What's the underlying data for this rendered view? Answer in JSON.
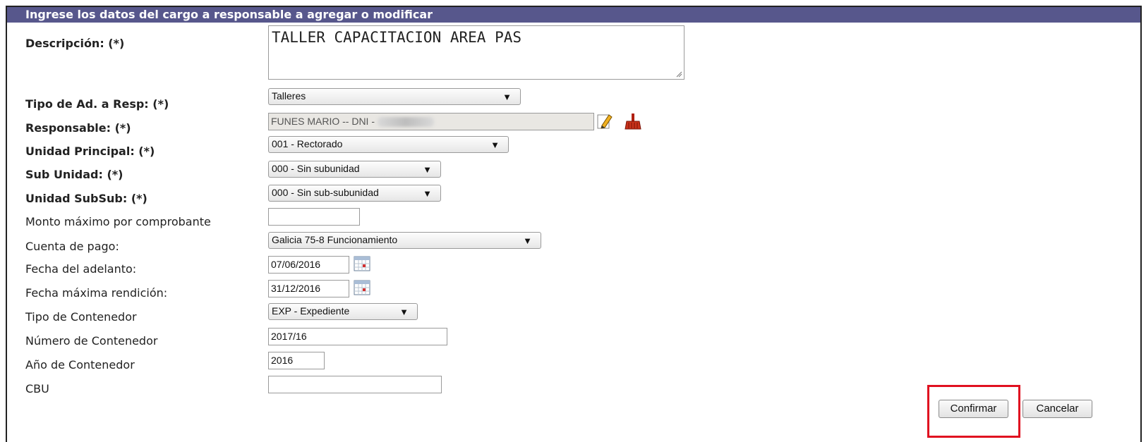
{
  "form": {
    "header": "Ingrese los datos del cargo a responsable a agregar o modificar",
    "descripcion": {
      "label": "Descripción: (*)",
      "value": "TALLER CAPACITACION AREA PAS"
    },
    "tipo_ad": {
      "label": "Tipo de Ad. a Resp: (*)",
      "value": "Talleres"
    },
    "responsable": {
      "label": "Responsable: (*)",
      "value": "FUNES MARIO -- DNI -"
    },
    "unidad_principal": {
      "label": "Unidad Principal: (*)",
      "value": "001 - Rectorado"
    },
    "sub_unidad": {
      "label": "Sub Unidad: (*)",
      "value": "000 - Sin subunidad"
    },
    "unidad_subsub": {
      "label": "Unidad SubSub: (*)",
      "value": "000 - Sin sub-subunidad"
    },
    "monto_maximo": {
      "label": "Monto máximo por comprobante",
      "value": ""
    },
    "cuenta_pago": {
      "label": "Cuenta de pago:",
      "value": "Galicia 75-8 Funcionamiento"
    },
    "fecha_adelanto": {
      "label": "Fecha del adelanto:",
      "value": "07/06/2016"
    },
    "fecha_rendicion": {
      "label": "Fecha máxima rendición:",
      "value": "31/12/2016"
    },
    "tipo_contenedor": {
      "label": "Tipo de Contenedor",
      "value": "EXP - Expediente"
    },
    "numero_contenedor": {
      "label": "Número de Contenedor",
      "value": "2017/16"
    },
    "anio_contenedor": {
      "label": "Año de Contenedor",
      "value": "2016"
    },
    "cbu": {
      "label": "CBU",
      "value": ""
    }
  },
  "buttons": {
    "confirmar": "Confirmar",
    "cancelar": "Cancelar"
  },
  "icons": {
    "edit": "edit-pencil-icon",
    "clear": "broom-clear-icon",
    "calendar": "calendar-icon",
    "dropdown": "triangle-down"
  },
  "colors": {
    "header_bg": "#57578c",
    "highlight": "#e01020"
  }
}
